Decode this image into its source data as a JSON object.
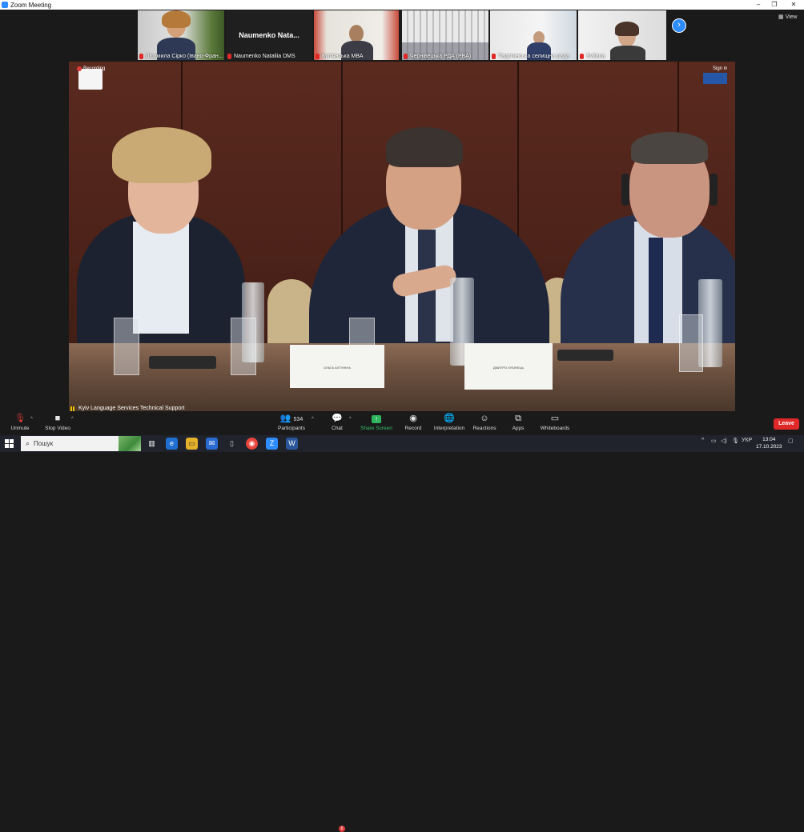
{
  "window": {
    "title": "Zoom Meeting",
    "controls": [
      "–",
      "❐",
      "✕"
    ]
  },
  "gallery": {
    "tiles": [
      {
        "name": "Людмила Сірко (Івано-Фран...",
        "type": "video"
      },
      {
        "name": "Naumenko Nataliia DMS",
        "display_name": "Naumenko  Nata...",
        "type": "name-only"
      },
      {
        "name": "Куп'янська МВА",
        "type": "video"
      },
      {
        "name": "Чернівецька РДА (РВА)",
        "type": "video"
      },
      {
        "name": "Тарутинська селищна рада",
        "type": "video"
      },
      {
        "name": "Svtlana",
        "type": "video"
      }
    ],
    "next_icon": "chevron-right-icon",
    "view_label": "View"
  },
  "main_video": {
    "recording_label": "Recording",
    "sign_in_label": "Sign in",
    "caption": "Kyiv Language Services Technical Support",
    "nameplates": [
      "ОЛЬГА АЛТУНІНА",
      "ДМИТРО ЛУБІНЕЦЬ"
    ]
  },
  "toolbar": {
    "unmute": "Unmute",
    "stop_video": "Stop Video",
    "participants_count": "534",
    "participants": "Participants",
    "chat": "Chat",
    "chat_badge": "6",
    "share_screen": "Share Screen",
    "record": "Record",
    "interpretation": "Interpretation",
    "reactions": "Reactions",
    "apps": "Apps",
    "whiteboards": "Whiteboards",
    "leave": "Leave",
    "share_color": "#2fb65d",
    "leave_color": "#e02828"
  },
  "taskbar": {
    "search_placeholder": "Пошук",
    "language": "УКР",
    "time": "13:04",
    "date": "17.10.2023"
  }
}
